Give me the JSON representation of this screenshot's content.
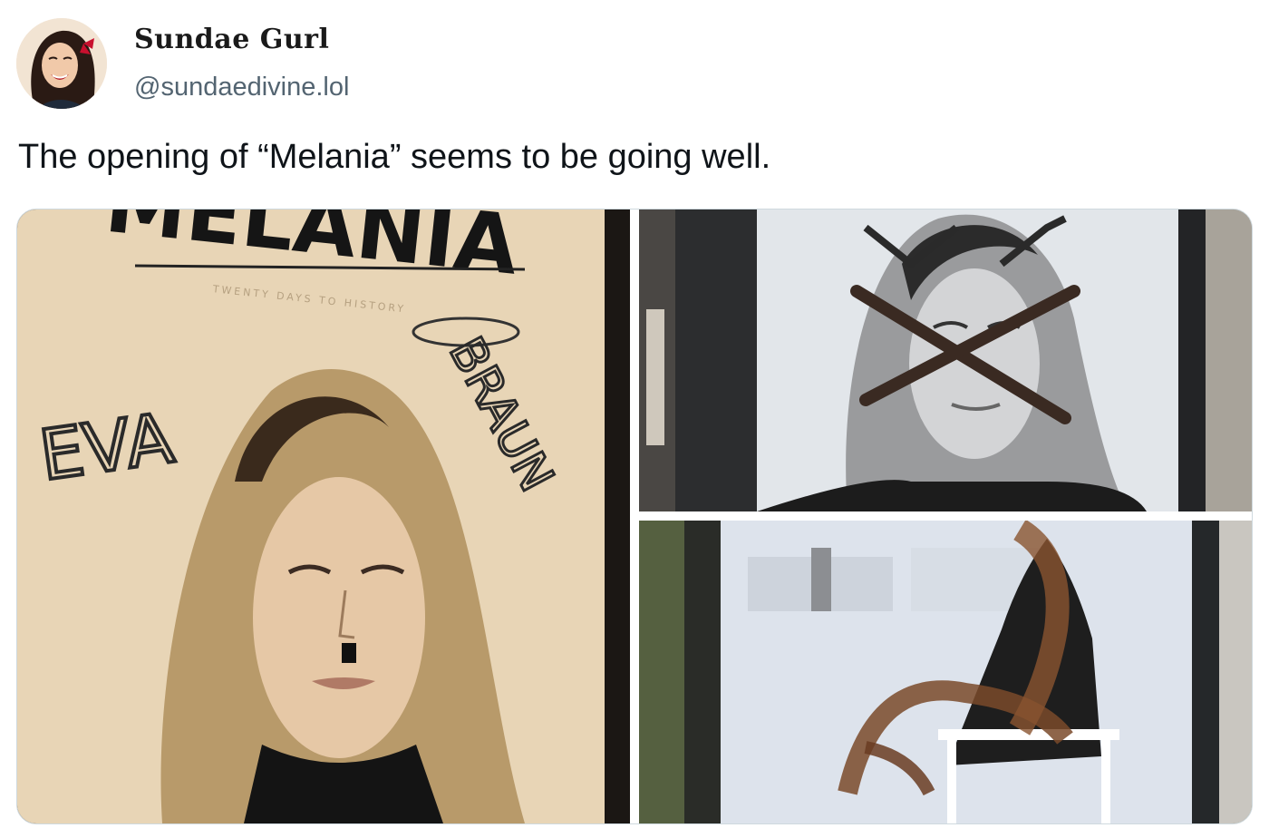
{
  "post": {
    "author_name": "Sundae Gurl",
    "author_handle": "@sundaedivine.lol",
    "text": "The opening of “Melania” seems to be going well."
  },
  "media": {
    "left_poster": {
      "title": "MELANIA",
      "subtitle": "TWENTY DAYS TO HISTORY",
      "graffiti_left": "EVA",
      "graffiti_right": "BRAUN"
    },
    "icons": {
      "avatar": "woman-smiling-portrait",
      "poster_1": "vandalized-poster-photo",
      "poster_2": "crossed-out-face-poster-photo",
      "poster_3": "paint-splattered-poster-photo"
    }
  },
  "colors": {
    "handle": "#536471",
    "text": "#0f1419",
    "border": "#cfd9de"
  }
}
